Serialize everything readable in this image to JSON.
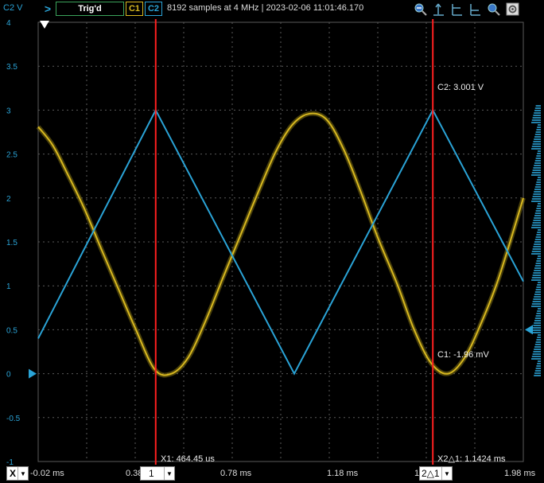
{
  "toolbar": {
    "channel_label": "C2 V",
    "run_arrow": ">",
    "trigger_status": "Trig'd",
    "channel1_button": "C1",
    "channel2_button": "C2",
    "info": "8192 samples at 4 MHz | 2023-02-06 11:01:46.170",
    "icons": [
      "zoom-reset-icon",
      "cursor-icon",
      "cursor-left-icon",
      "cursor-right-icon",
      "zoom-icon",
      "settings-icon"
    ]
  },
  "colors": {
    "background": "#000000",
    "grid": "#5a5a5a",
    "channel1": "#d8b820",
    "channel2": "#2aa3d6",
    "cursor": "#ff2020"
  },
  "annotations": {
    "c2_value": "C2: 3.001 V",
    "c1_value": "C1: -1.96 mV",
    "x1_label": "X1: 464.45 us",
    "delta_label": "X2△1: 1.1424 ms"
  },
  "bottombar": {
    "axis_select": "X",
    "x_start": "-0.02 ms",
    "x_tick1_partial": "0.38",
    "cursor1_select": "1",
    "x_tick2": "0.78 ms",
    "x_tick3": "1.18 ms",
    "x_tick4_partial": "1",
    "cursor2_select": "2△1",
    "x_end": "1.98 ms"
  },
  "chart_data": {
    "type": "line",
    "ylabel": "C2 V",
    "ylim": [
      -1,
      4
    ],
    "xlim": [
      -0.02,
      1.98
    ],
    "y_ticks": [
      "4",
      "3.5",
      "3",
      "2.5",
      "2",
      "1.5",
      "1",
      "0.5",
      "0",
      "-0.5",
      "-1"
    ],
    "x_unit": "ms",
    "grid": true,
    "series": [
      {
        "name": "C1",
        "color": "#d8b820",
        "x": [
          -0.02,
          0.04,
          0.1,
          0.17,
          0.24,
          0.31,
          0.38,
          0.46,
          0.53,
          0.6,
          0.67,
          0.74,
          0.81,
          0.88,
          0.96,
          1.03,
          1.1,
          1.17,
          1.24,
          1.31,
          1.38,
          1.46,
          1.53,
          1.6,
          1.67,
          1.74,
          1.81,
          1.88,
          1.98
        ],
        "y": [
          2.81,
          2.6,
          2.28,
          1.88,
          1.42,
          0.97,
          0.52,
          0.05,
          0.0,
          0.19,
          0.6,
          1.08,
          1.55,
          2.02,
          2.53,
          2.84,
          2.96,
          2.89,
          2.55,
          2.07,
          1.55,
          1.02,
          0.5,
          0.12,
          0.0,
          0.19,
          0.6,
          1.1,
          2.0
        ]
      },
      {
        "name": "C2",
        "color": "#2aa3d6",
        "x": [
          -0.02,
          0.4645,
          1.0357,
          1.6069,
          1.98
        ],
        "y": [
          0.4,
          3.0,
          0.0,
          3.0,
          1.05
        ]
      }
    ],
    "cursors": [
      {
        "name": "X1",
        "x": 0.4645
      },
      {
        "name": "X2",
        "x": 1.6069
      }
    ],
    "markers": {
      "c1_ground_y": 0.0,
      "c2_ground_y": 0.5
    }
  }
}
